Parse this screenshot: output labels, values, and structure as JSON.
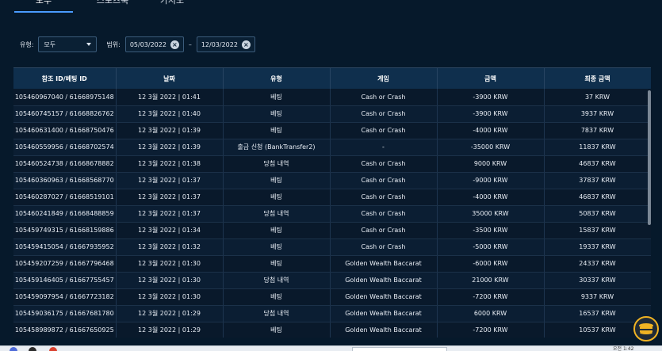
{
  "tabs": [
    {
      "label": "모두"
    },
    {
      "label": "스포츠북"
    },
    {
      "label": "카지노"
    }
  ],
  "filters": {
    "type_label": "유형:",
    "type_value": "모두",
    "range_label": "범위:",
    "date_from": "05/03/2022",
    "date_to": "12/03/2022",
    "separator": "–"
  },
  "table": {
    "headers": [
      "참조 ID/베팅 ID",
      "날짜",
      "유형",
      "게임",
      "금액",
      "최종 금액"
    ],
    "rows": [
      [
        "105460967040 / 61668975148",
        "12 3월 2022 | 01:41",
        "베팅",
        "Cash or Crash",
        "-3900 KRW",
        "37 KRW"
      ],
      [
        "105460745157 / 61668826762",
        "12 3월 2022 | 01:40",
        "베팅",
        "Cash or Crash",
        "-3900 KRW",
        "3937 KRW"
      ],
      [
        "105460631400 / 61668750476",
        "12 3월 2022 | 01:39",
        "베팅",
        "Cash or Crash",
        "-4000 KRW",
        "7837 KRW"
      ],
      [
        "105460559956 / 61668702574",
        "12 3월 2022 | 01:39",
        "출금 신청 (BankTransfer2)",
        "-",
        "-35000 KRW",
        "11837 KRW"
      ],
      [
        "105460524738 / 61668678882",
        "12 3월 2022 | 01:38",
        "당첨 내역",
        "Cash or Crash",
        "9000 KRW",
        "46837 KRW"
      ],
      [
        "105460360963 / 61668568770",
        "12 3월 2022 | 01:37",
        "베팅",
        "Cash or Crash",
        "-9000 KRW",
        "37837 KRW"
      ],
      [
        "105460287027 / 61668519101",
        "12 3월 2022 | 01:37",
        "베팅",
        "Cash or Crash",
        "-4000 KRW",
        "46837 KRW"
      ],
      [
        "105460241849 / 61668488859",
        "12 3월 2022 | 01:37",
        "당첨 내역",
        "Cash or Crash",
        "35000 KRW",
        "50837 KRW"
      ],
      [
        "105459749315 / 61668159886",
        "12 3월 2022 | 01:34",
        "베팅",
        "Cash or Crash",
        "-3500 KRW",
        "15837 KRW"
      ],
      [
        "105459415054 / 61667935952",
        "12 3월 2022 | 01:32",
        "베팅",
        "Cash or Crash",
        "-5000 KRW",
        "19337 KRW"
      ],
      [
        "105459207259 / 61667796468",
        "12 3월 2022 | 01:30",
        "베팅",
        "Golden Wealth Baccarat",
        "-6000 KRW",
        "24337 KRW"
      ],
      [
        "105459146405 / 61667755457",
        "12 3월 2022 | 01:30",
        "당첨 내역",
        "Golden Wealth Baccarat",
        "21000 KRW",
        "30337 KRW"
      ],
      [
        "105459097954 / 61667723182",
        "12 3월 2022 | 01:30",
        "베팅",
        "Golden Wealth Baccarat",
        "-7200 KRW",
        "9337 KRW"
      ],
      [
        "105459036175 / 61667681780",
        "12 3월 2022 | 01:29",
        "당첨 내역",
        "Golden Wealth Baccarat",
        "6000 KRW",
        "16537 KRW"
      ],
      [
        "105458989872 / 61667650925",
        "12 3월 2022 | 01:29",
        "베팅",
        "Golden Wealth Baccarat",
        "-7200 KRW",
        "10537 KRW"
      ]
    ]
  },
  "taskbar": {
    "time": "오전 1:42"
  },
  "icons": {
    "select_caret": "caret-down-icon",
    "clear": "close-circle-icon",
    "fab": "helper-icon"
  },
  "colors": {
    "background": "#06192b",
    "header_bg": "#0f2f4d",
    "accent": "#4a9bff",
    "fab_ring": "#f0b323"
  }
}
